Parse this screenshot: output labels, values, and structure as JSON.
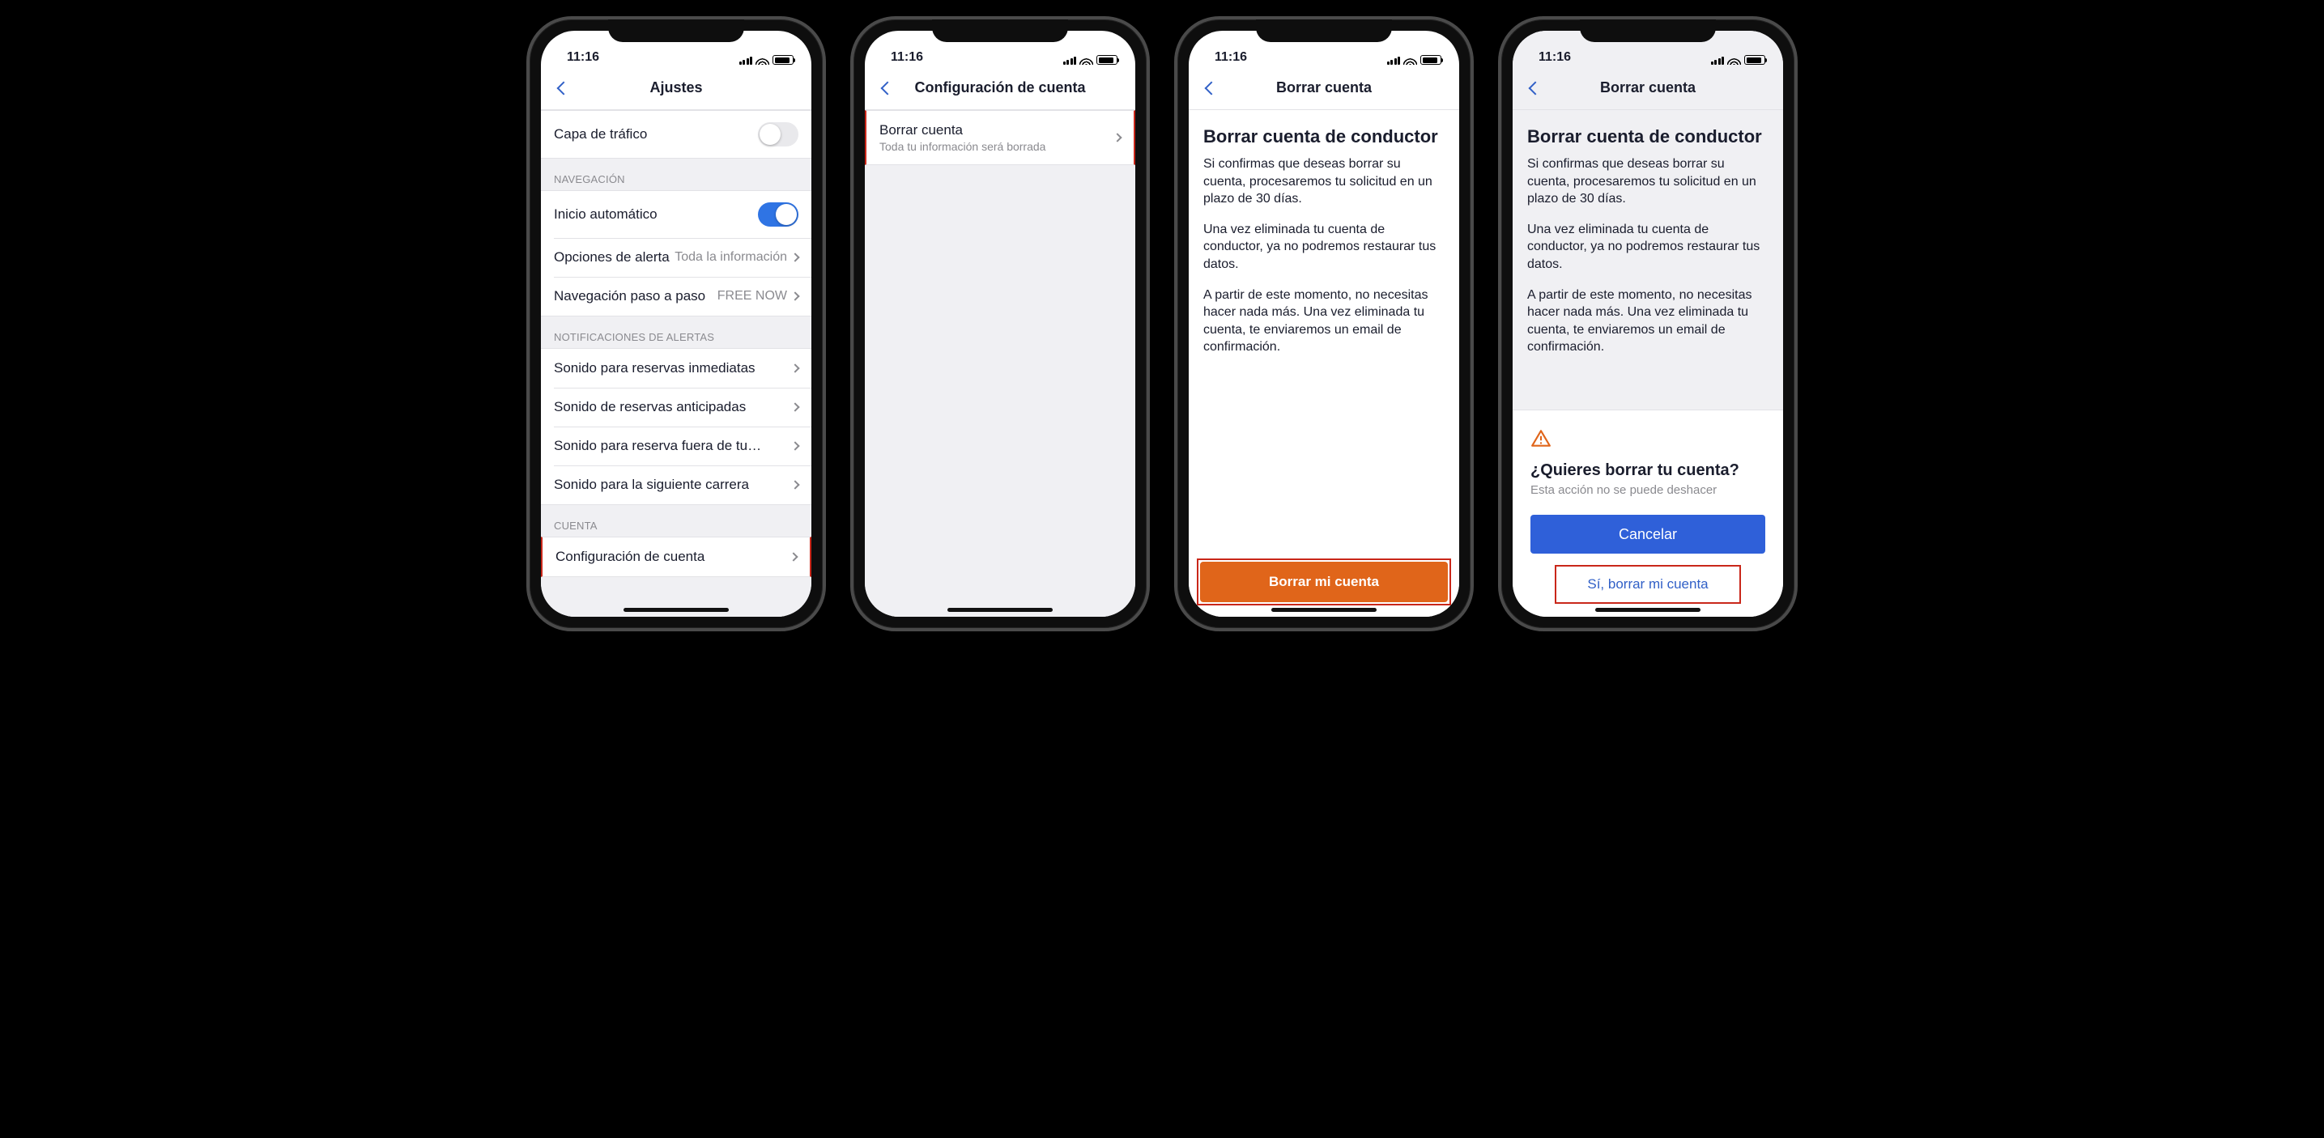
{
  "status": {
    "time": "11:16"
  },
  "colors": {
    "accent_blue": "#2f60d9",
    "action_orange": "#e0651a",
    "highlight": "#c9271a"
  },
  "screen1": {
    "nav_title": "Ajustes",
    "row_traffic_layer": "Capa de tráfico",
    "traffic_layer_on": false,
    "section_nav": "NAVEGACIÓN",
    "row_autostart": "Inicio automático",
    "autostart_on": true,
    "row_alert_opts": "Opciones de alerta",
    "row_alert_opts_value": "Toda la información",
    "row_turnbyturn": "Navegación paso a paso",
    "row_turnbyturn_value": "FREE NOW",
    "section_alerts": "NOTIFICACIONES DE ALERTAS",
    "row_sound_immediate": "Sonido para reservas inmediatas",
    "row_sound_advance": "Sonido de reservas anticipadas",
    "row_sound_outside": "Sonido para reserva fuera de tu…",
    "row_sound_next": "Sonido para la siguiente carrera",
    "section_account": "CUENTA",
    "row_account_settings": "Configuración de cuenta"
  },
  "screen2": {
    "nav_title": "Configuración de cuenta",
    "row_delete_title": "Borrar cuenta",
    "row_delete_sub": "Toda tu información será borrada"
  },
  "screen3": {
    "nav_title": "Borrar cuenta",
    "page_title": "Borrar cuenta de conductor",
    "para1": "Si confirmas que deseas borrar su cuenta, procesaremos tu solicitud en un plazo de 30 días.",
    "para2": "Una vez eliminada tu cuenta de conductor, ya no podremos restaurar tus datos.",
    "para3": "A partir de este momento, no necesitas hacer nada más. Una vez eliminada tu cuenta, te enviaremos un email de confirmación.",
    "cta": "Borrar mi cuenta"
  },
  "screen4": {
    "nav_title": "Borrar cuenta",
    "page_title": "Borrar cuenta de conductor",
    "para1": "Si confirmas que deseas borrar su cuenta, procesaremos tu solicitud en un plazo de 30 días.",
    "para2": "Una vez eliminada tu cuenta de conductor, ya no podremos restaurar tus datos.",
    "para3": "A partir de este momento, no necesitas hacer nada más. Una vez eliminada tu cuenta, te enviaremos un email de confirmación.",
    "sheet_title": "¿Quieres borrar tu cuenta?",
    "sheet_sub": "Esta acción no se puede deshacer",
    "btn_cancel": "Cancelar",
    "btn_confirm": "Sí, borrar mi cuenta"
  }
}
